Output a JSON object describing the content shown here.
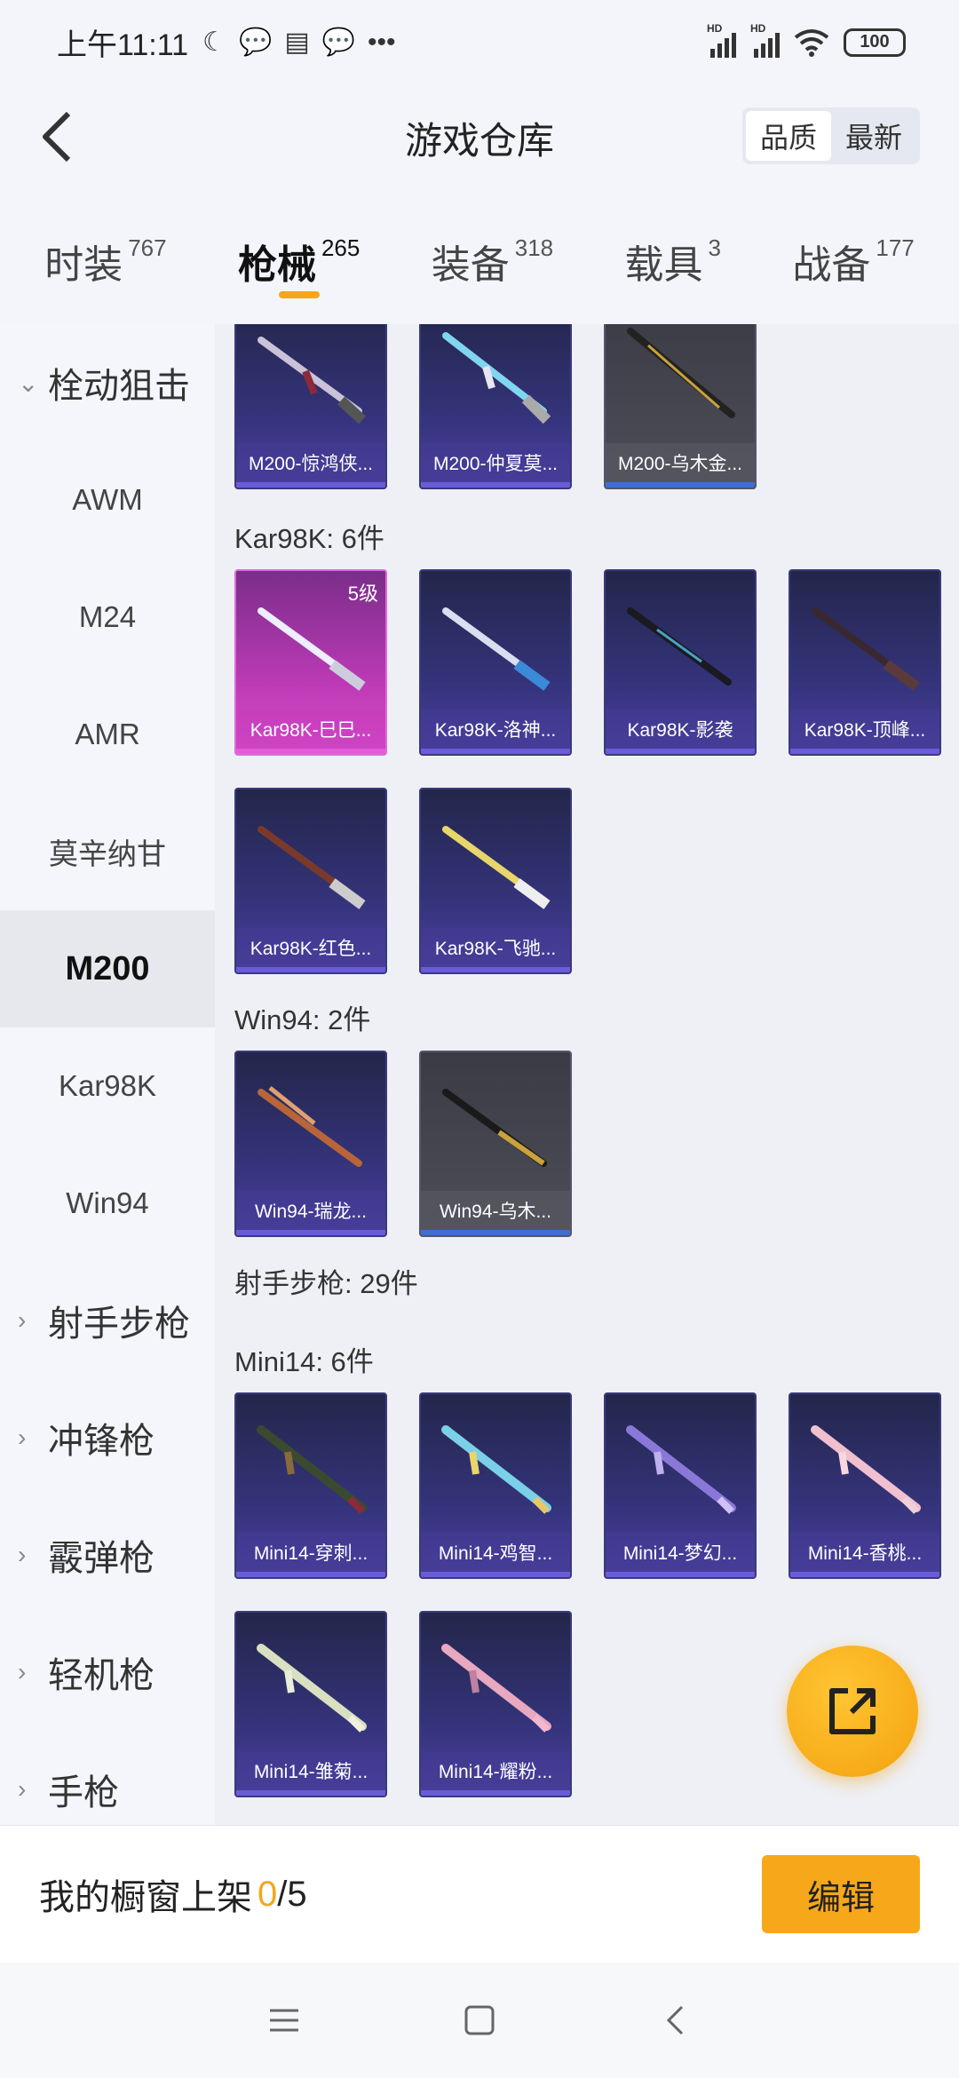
{
  "status_bar": {
    "time": "上午11:11",
    "battery": "100",
    "signal_label": "HD"
  },
  "header": {
    "title": "游戏仓库",
    "sort_quality": "品质",
    "sort_newest": "最新"
  },
  "tabs": [
    {
      "label": "时装",
      "count": "767"
    },
    {
      "label": "枪械",
      "count": "265"
    },
    {
      "label": "装备",
      "count": "318"
    },
    {
      "label": "载具",
      "count": "3"
    },
    {
      "label": "战备",
      "count": "177"
    }
  ],
  "sidebar": {
    "items": [
      {
        "label": "栓动狙击",
        "type": "group-open"
      },
      {
        "label": "AWM",
        "type": "sub"
      },
      {
        "label": "M24",
        "type": "sub"
      },
      {
        "label": "AMR",
        "type": "sub"
      },
      {
        "label": "莫辛纳甘",
        "type": "sub"
      },
      {
        "label": "M200",
        "type": "sub-active"
      },
      {
        "label": "Kar98K",
        "type": "sub"
      },
      {
        "label": "Win94",
        "type": "sub"
      },
      {
        "label": "射手步枪",
        "type": "group"
      },
      {
        "label": "冲锋枪",
        "type": "group"
      },
      {
        "label": "霰弹枪",
        "type": "group"
      },
      {
        "label": "轻机枪",
        "type": "group"
      },
      {
        "label": "手枪",
        "type": "group"
      }
    ]
  },
  "content": {
    "m200_cards": [
      {
        "name": "M200-惊鸿侠...",
        "rarity": "purple"
      },
      {
        "name": "M200-仲夏莫...",
        "rarity": "purple"
      },
      {
        "name": "M200-乌木金...",
        "rarity": "grey"
      }
    ],
    "kar98k_title": "Kar98K: 6件",
    "kar98k_cards": [
      {
        "name": "Kar98K-巳巳...",
        "rarity": "pink",
        "level": "5级"
      },
      {
        "name": "Kar98K-洛神...",
        "rarity": "purple"
      },
      {
        "name": "Kar98K-影袭",
        "rarity": "purple"
      },
      {
        "name": "Kar98K-顶峰...",
        "rarity": "purple"
      },
      {
        "name": "Kar98K-红色...",
        "rarity": "purple"
      },
      {
        "name": "Kar98K-飞驰...",
        "rarity": "purple"
      }
    ],
    "win94_title": "Win94: 2件",
    "win94_cards": [
      {
        "name": "Win94-瑞龙...",
        "rarity": "purple"
      },
      {
        "name": "Win94-乌木...",
        "rarity": "grey"
      }
    ],
    "marksman_title": "射手步枪: 29件",
    "mini14_title": "Mini14: 6件",
    "mini14_cards": [
      {
        "name": "Mini14-穿刺...",
        "rarity": "purple"
      },
      {
        "name": "Mini14-鸡智...",
        "rarity": "purple"
      },
      {
        "name": "Mini14-梦幻...",
        "rarity": "purple"
      },
      {
        "name": "Mini14-香桃...",
        "rarity": "purple"
      },
      {
        "name": "Mini14-雏菊...",
        "rarity": "purple"
      },
      {
        "name": "Mini14-耀粉...",
        "rarity": "purple"
      }
    ]
  },
  "bottom_bar": {
    "showcase_label": "我的橱窗上架",
    "showcase_count": "0",
    "showcase_sep": "/",
    "showcase_total": "5",
    "edit_label": "编辑"
  },
  "colors": {
    "accent": "#f2a81a",
    "card_purple": "#34337a",
    "card_pink": "#c03bb8",
    "card_grey": "#4d4e58"
  }
}
